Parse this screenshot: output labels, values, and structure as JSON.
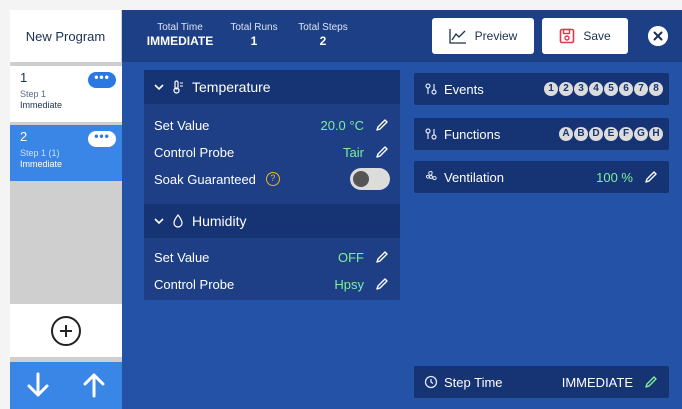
{
  "program": {
    "title": "New Program"
  },
  "steps": [
    {
      "number": "1",
      "label": "Step 1",
      "mode": "Immediate"
    },
    {
      "number": "2",
      "label": "Step 1 (1)",
      "mode": "Immediate"
    }
  ],
  "step_menu_glyph": "•••",
  "header": {
    "total_time_label": "Total Time",
    "total_time_value": "IMMEDIATE",
    "total_runs_label": "Total Runs",
    "total_runs_value": "1",
    "total_steps_label": "Total Steps",
    "total_steps_value": "2",
    "preview_label": "Preview",
    "save_label": "Save"
  },
  "temperature": {
    "title": "Temperature",
    "set_value_label": "Set Value",
    "set_value": "20.0 °C",
    "control_probe_label": "Control Probe",
    "control_probe": "Tair",
    "soak_label": "Soak Guaranteed",
    "soak_help": "?",
    "soak_enabled": false
  },
  "humidity": {
    "title": "Humidity",
    "set_value_label": "Set Value",
    "set_value": "OFF",
    "control_probe_label": "Control Probe",
    "control_probe": "Hpsy"
  },
  "events": {
    "label": "Events",
    "items": [
      "1",
      "2",
      "3",
      "4",
      "5",
      "6",
      "7",
      "8"
    ]
  },
  "functions": {
    "label": "Functions",
    "items": [
      "A",
      "B",
      "D",
      "E",
      "F",
      "G",
      "H"
    ]
  },
  "ventilation": {
    "label": "Ventilation",
    "value": "100 %"
  },
  "step_time": {
    "label": "Step Time",
    "value": "IMMEDIATE"
  },
  "icons": {
    "expand": "chevron-down-icon",
    "temperature": "thermometer-icon",
    "humidity": "droplet-icon",
    "events": "toggle-icon",
    "functions": "toggle-icon",
    "ventilation": "fan-icon",
    "step_time": "clock-icon",
    "edit": "pencil-icon",
    "preview": "chart-line-icon",
    "save": "floppy-disk-icon",
    "close": "close-icon",
    "add": "plus-circle-icon",
    "down": "arrow-down-icon",
    "up": "arrow-up-icon"
  },
  "colors": {
    "background": "#2352a6",
    "header": "#1d3f86",
    "panel_head": "#163374",
    "accent_blue": "#3a86e6",
    "value_green": "#7cf09f",
    "save_red": "#e2364b",
    "help_amber": "#f0b429"
  }
}
